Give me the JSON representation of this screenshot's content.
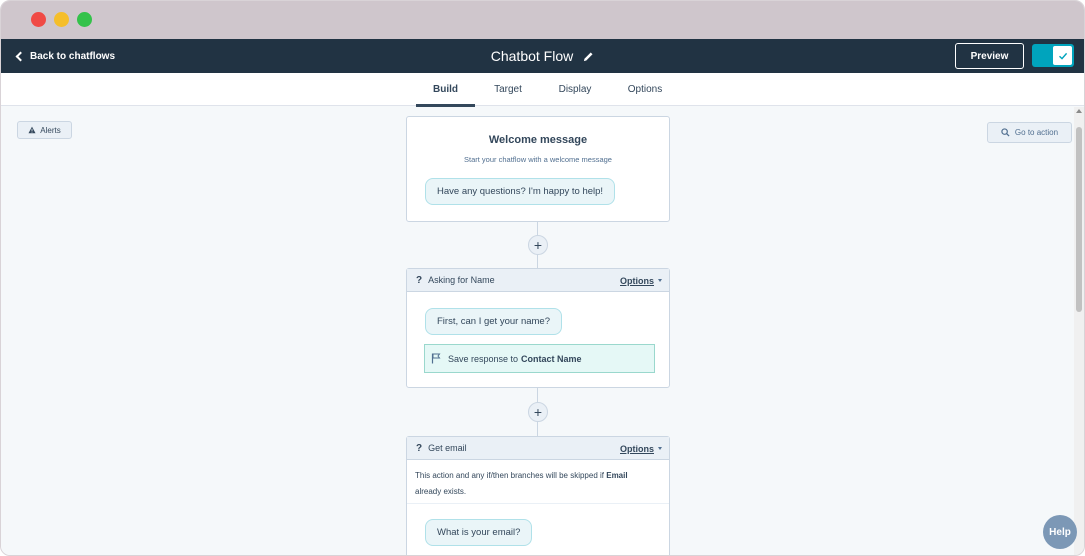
{
  "header": {
    "back_label": "Back to chatflows",
    "title": "Chatbot Flow",
    "preview_label": "Preview",
    "toggle_state": "on"
  },
  "tabs": [
    {
      "label": "Build",
      "active": true
    },
    {
      "label": "Target",
      "active": false
    },
    {
      "label": "Display",
      "active": false
    },
    {
      "label": "Options",
      "active": false
    }
  ],
  "canvas": {
    "alerts_label": "Alerts",
    "goto_label": "Go to action"
  },
  "welcome": {
    "title": "Welcome message",
    "subtitle": "Start your chatflow with a welcome message",
    "message": "Have any questions? I'm happy to help!"
  },
  "actions": [
    {
      "icon": "?",
      "name": "Asking for Name",
      "options_label": "Options",
      "message": "First, can I get your name?",
      "save_prefix": "Save response to",
      "save_target": "Contact Name"
    },
    {
      "icon": "?",
      "name": "Get email",
      "options_label": "Options",
      "note_prefix": "This action and any if/then branches will be skipped if",
      "note_bold": "Email",
      "note_suffix": "already exists.",
      "message": "What is your email?"
    }
  ],
  "help_label": "Help",
  "colors": {
    "navbar": "#213343",
    "accent": "#00a4bd",
    "canvas": "#f5f8fa"
  }
}
